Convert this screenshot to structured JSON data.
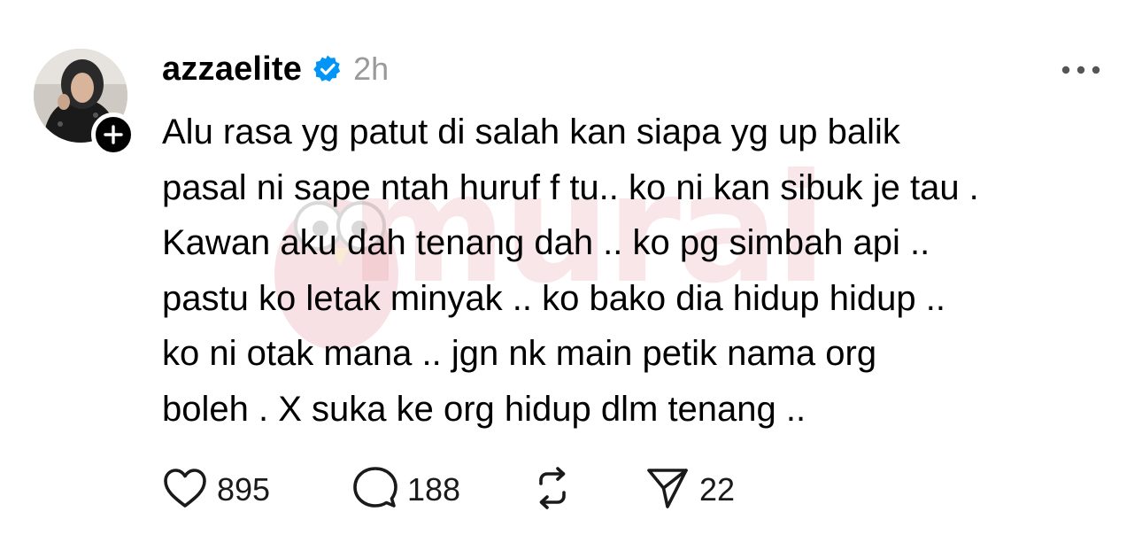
{
  "post": {
    "username": "azzaelite",
    "timestamp": "2h",
    "text_lines": [
      "Alu rasa yg patut di salah kan siapa yg up balik",
      "pasal ni sape ntah huruf f tu.. ko ni kan sibuk je tau .",
      "Kawan aku dah tenang dah .. ko pg simbah api ..",
      "pastu ko letak minyak .. ko bako dia hidup hidup ..",
      "ko ni otak mana .. jgn nk main petik nama org",
      "boleh . X suka ke org hidup dlm tenang .."
    ],
    "watermark": "murai"
  },
  "actions": {
    "likes": "895",
    "replies": "188",
    "shares": "22"
  },
  "icons": {
    "verified": "verified-badge-icon",
    "follow": "plus-icon",
    "more": "more-horizontal-icon",
    "like": "heart-icon",
    "reply": "comment-icon",
    "repost": "repost-icon",
    "share": "send-icon"
  },
  "colors": {
    "verified": "#0095f6",
    "timestamp": "#9a9a9a",
    "watermark": "#e07a8a"
  }
}
